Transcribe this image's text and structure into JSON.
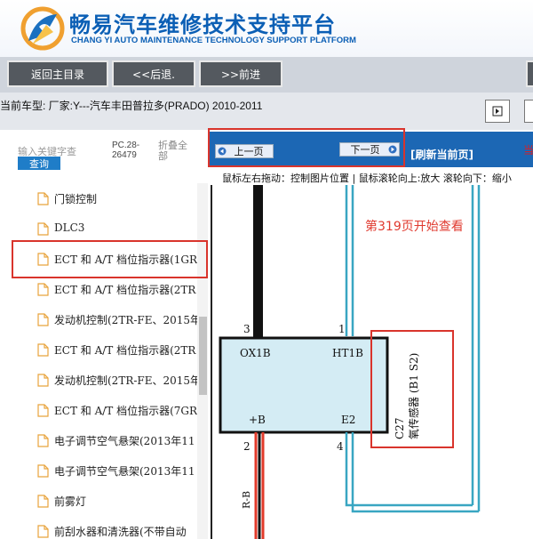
{
  "header": {
    "title": "畅易汽车维修技术支持平台",
    "subtitle": "CHANG YI AUTO MAINTENANCE TECHNOLOGY SUPPORT PLATFORM"
  },
  "toolbar": {
    "home_label": "返回主目录",
    "back_label": "<<后退.",
    "forward_label": ">>前进"
  },
  "info": {
    "vehicle": "当前车型:  厂家:Y---汽车丰田普拉多(PRADO) 2010-2011"
  },
  "sidebar": {
    "search_placeholder": "输入关键字查",
    "query_label": "查询",
    "pc_line1": "PC.28-",
    "pc_line2": "26479",
    "collapse_line1": "折叠全",
    "collapse_line2": "部",
    "items": [
      {
        "label": "门锁控制"
      },
      {
        "label": "DLC3"
      },
      {
        "label": "ECT 和 A/T 档位指示器(1GR"
      },
      {
        "label": "ECT 和 A/T 档位指示器(2TR"
      },
      {
        "label": "发动机控制(2TR-FE、2015年"
      },
      {
        "label": "ECT 和 A/T 档位指示器(2TR"
      },
      {
        "label": "发动机控制(2TR-FE、2015年"
      },
      {
        "label": "ECT 和 A/T 档位指示器(7GR"
      },
      {
        "label": "电子调节空气悬架(2013年11"
      },
      {
        "label": "电子调节空气悬架(2013年11"
      },
      {
        "label": "前雾灯"
      },
      {
        "label": "前刮水器和清洗器(不带自动"
      }
    ]
  },
  "viewer": {
    "prev_label": "上一页",
    "next_label": "下一页",
    "refresh_label": "[刷新当前页]",
    "current_edge": "当",
    "hint": "鼠标左右拖动：控制图片位置 | 鼠标滚轮向上:放大  滚轮向下：缩小",
    "annotation": "第319页开始查看"
  },
  "diagram": {
    "pin_left_top": "3",
    "pin_right_top": "1",
    "pin_left_bottom": "2",
    "pin_right_bottom": "4",
    "label_0x1b": "OX1B",
    "label_ht1b": "HT1B",
    "label_plus_b": "+B",
    "label_e2": "E2",
    "component_code": "C27",
    "component_name": "氧传感器 (B1 S2)",
    "wire_label": "R-B"
  },
  "colors": {
    "brand_blue": "#0b5fb5",
    "nav_blue": "#1c67b4",
    "highlight_red": "#d9342c",
    "box_fill": "#d4ecf4",
    "wire_cyan": "#39a6c2"
  }
}
